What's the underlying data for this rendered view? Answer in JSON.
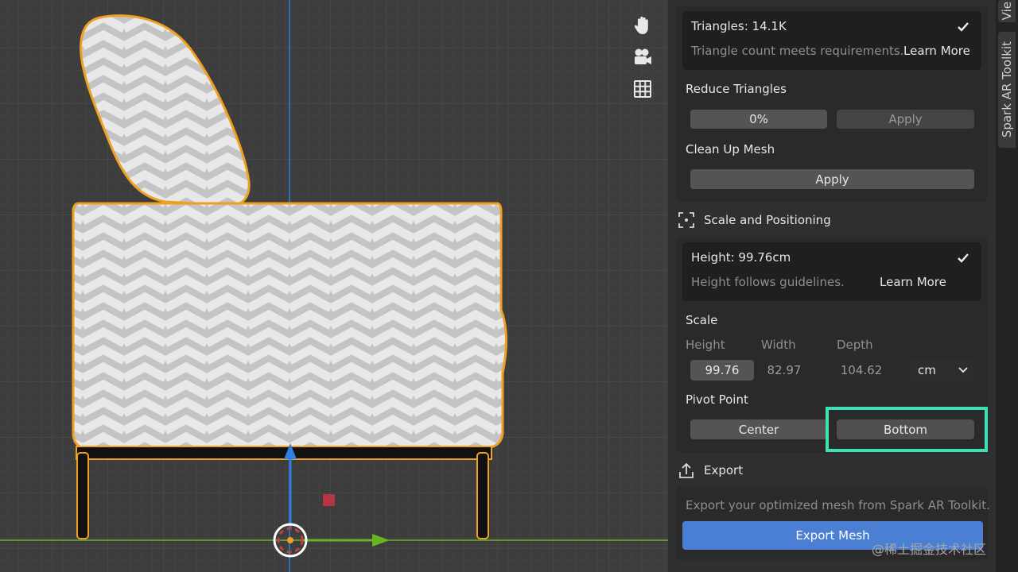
{
  "viewport": {
    "tools": [
      {
        "icon": "hand-icon"
      },
      {
        "icon": "camera-icon"
      },
      {
        "icon": "grid-icon"
      }
    ]
  },
  "panel": {
    "triangles": {
      "title": "Triangles: 14.1K",
      "status": "Triangle count meets requirements.",
      "learn_more": "Learn More"
    },
    "reduce_triangles": {
      "label": "Reduce Triangles",
      "value": "0%",
      "apply_label": "Apply"
    },
    "clean_up": {
      "label": "Clean Up Mesh",
      "apply_label": "Apply"
    },
    "scale_section": {
      "title": "Scale and Positioning",
      "height_card": {
        "title": "Height: 99.76cm",
        "status": "Height follows guidelines.",
        "learn_more": "Learn More"
      },
      "scale_label": "Scale",
      "col_height": "Height",
      "col_width": "Width",
      "col_depth": "Depth",
      "height_value": "99.76",
      "width_value": "82.97",
      "depth_value": "104.62",
      "unit": "cm",
      "pivot_label": "Pivot Point",
      "pivot_center": "Center",
      "pivot_bottom": "Bottom"
    },
    "export_section": {
      "title": "Export",
      "description": "Export your optimized mesh from Spark AR Toolkit.",
      "button": "Export Mesh"
    }
  },
  "tabs": {
    "toolkit": "Spark AR Toolkit",
    "view": "Vie"
  },
  "watermark": "@稀土掘金技术社区",
  "colors": {
    "accent_blue": "#4a7fd4",
    "highlight_teal": "#3fe0b4",
    "selection_orange": "#f0a020",
    "axis_y_blue": "#2f7fdf",
    "axis_x_green": "#6ab324"
  }
}
